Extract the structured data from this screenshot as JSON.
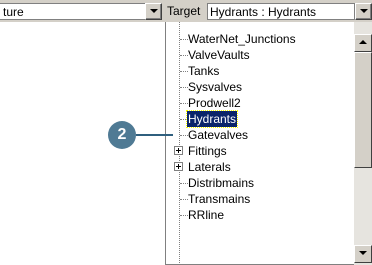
{
  "toolbar": {
    "left_combo_value": "ture",
    "target_label": "Target",
    "target_value": "Hydrants : Hydrants"
  },
  "tree": {
    "items": [
      {
        "label": "WaterNet_Junctions",
        "expandable": false,
        "selected": false
      },
      {
        "label": "ValveVaults",
        "expandable": false,
        "selected": false
      },
      {
        "label": "Tanks",
        "expandable": false,
        "selected": false
      },
      {
        "label": "Sysvalves",
        "expandable": false,
        "selected": false
      },
      {
        "label": "Prodwell2",
        "expandable": false,
        "selected": false
      },
      {
        "label": "Hydrants",
        "expandable": false,
        "selected": true
      },
      {
        "label": "Gatevalves",
        "expandable": false,
        "selected": false
      },
      {
        "label": "Fittings",
        "expandable": true,
        "selected": false
      },
      {
        "label": "Laterals",
        "expandable": true,
        "selected": false
      },
      {
        "label": "Distribmains",
        "expandable": false,
        "selected": false
      },
      {
        "label": "Transmains",
        "expandable": false,
        "selected": false
      },
      {
        "label": "RRline",
        "expandable": false,
        "selected": false
      }
    ]
  },
  "callout": {
    "number": "2"
  },
  "icons": {
    "dropdown": "chevron-down-icon",
    "scroll_up": "arrow-up-icon",
    "scroll_down": "arrow-down-icon",
    "expand": "plus-box-icon"
  },
  "colors": {
    "selection": "#0a246a",
    "callout": "#4f7a94",
    "panel": "#d4d0c8"
  }
}
